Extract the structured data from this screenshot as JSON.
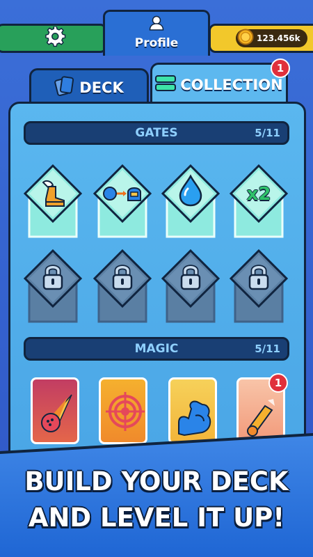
{
  "topbar": {
    "settings_icon": "gear-icon",
    "profile_label": "Profile",
    "profile_icon": "user-icon",
    "coins_value": "123.456k",
    "coin_icon": "coin-icon"
  },
  "tabs": {
    "deck_label": "DECK",
    "collection_label": "COLLECTION",
    "collection_badge": "1"
  },
  "gates_section": {
    "title": "GATES",
    "count": "5/11",
    "unlocked": [
      {
        "icon": "winged-boot-icon"
      },
      {
        "icon": "ball-to-helmet-icon"
      },
      {
        "icon": "water-drop-icon"
      },
      {
        "icon": "multiplier-icon",
        "text": "x2"
      }
    ],
    "locked_icon": "padlock-icon"
  },
  "magic_section": {
    "title": "MAGIC",
    "count": "5/11",
    "cards": [
      {
        "icon": "meteor-icon",
        "color": "#d4485a"
      },
      {
        "icon": "target-icon",
        "color": "#f0a42a"
      },
      {
        "icon": "flexed-arm-icon",
        "color": "#f6c54a"
      },
      {
        "icon": "cannon-icon",
        "color": "#f3a889",
        "badge": "1"
      }
    ]
  },
  "promo": {
    "line1": "BUILD YOUR DECK",
    "line2": "AND LEVEL IT UP!"
  },
  "colors": {
    "background": "#3b6fd8",
    "panel": "#5ab7ef",
    "accent_green": "#28a05a",
    "accent_yellow": "#f2c82b",
    "badge_red": "#e0303c"
  }
}
